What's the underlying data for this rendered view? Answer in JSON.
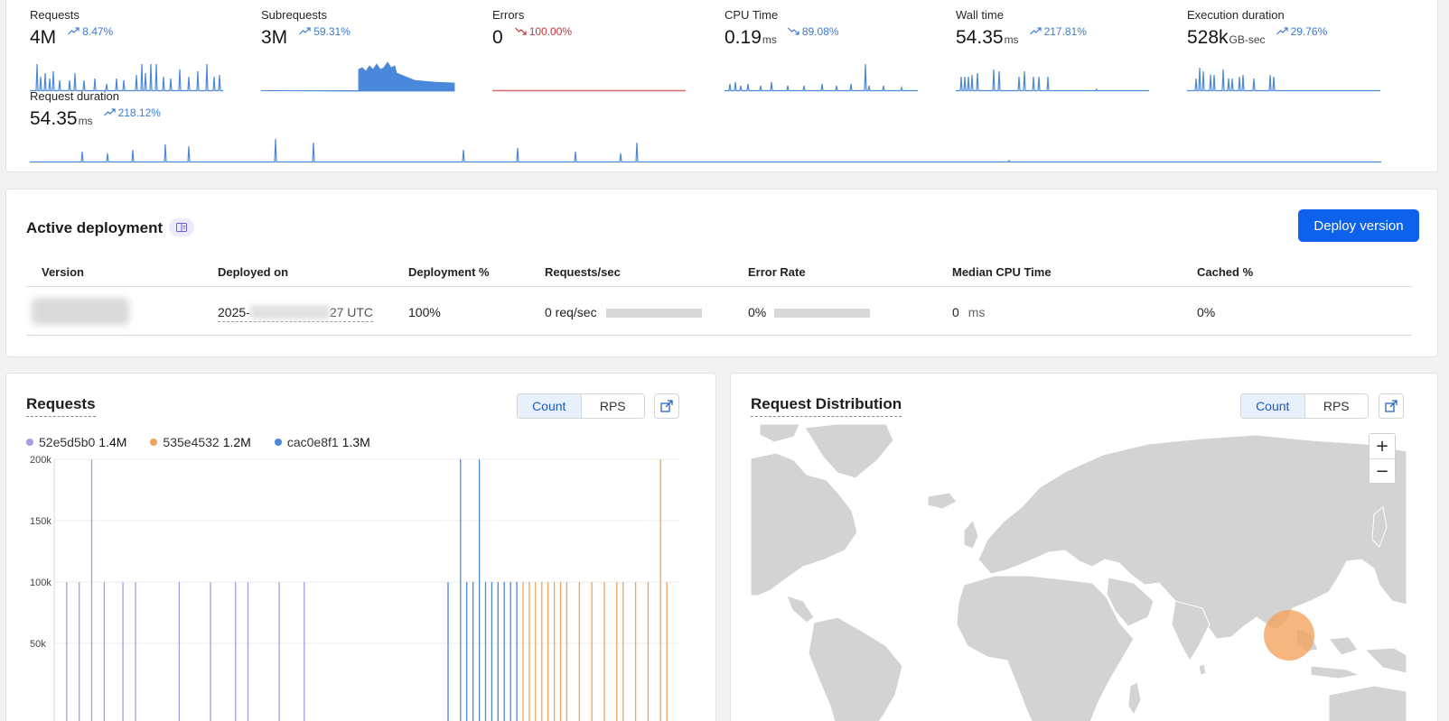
{
  "metrics": [
    {
      "label": "Requests",
      "value": "4M",
      "unit": "",
      "delta": "8.47%",
      "trend": "up"
    },
    {
      "label": "Subrequests",
      "value": "3M",
      "unit": "",
      "delta": "59.31%",
      "trend": "up"
    },
    {
      "label": "Errors",
      "value": "0",
      "unit": "",
      "delta": "100.00%",
      "trend": "down"
    },
    {
      "label": "CPU Time",
      "value": "0.19",
      "unit": "ms",
      "delta": "89.08%",
      "trend": "down"
    },
    {
      "label": "Wall time",
      "value": "54.35",
      "unit": "ms",
      "delta": "217.81%",
      "trend": "up"
    },
    {
      "label": "Execution duration",
      "value": "528k",
      "unit": "GB-sec",
      "delta": "29.76%",
      "trend": "up"
    }
  ],
  "request_duration": {
    "label": "Request duration",
    "value": "54.35",
    "unit": "ms",
    "delta": "218.12%",
    "trend": "up"
  },
  "deployment": {
    "title": "Active deployment",
    "button": "Deploy version",
    "columns": [
      "Version",
      "Deployed on",
      "Deployment %",
      "Requests/sec",
      "Error Rate",
      "Median CPU Time",
      "Cached %"
    ],
    "row": {
      "deployed_on_prefix": "2025-",
      "deployed_on_suffix": "27 UTC",
      "deployment_pct": "100%",
      "requests_sec": "0 req/sec",
      "error_rate": "0%",
      "median_cpu": "0",
      "median_cpu_unit": "ms",
      "cached": "0%"
    }
  },
  "requests_panel": {
    "title": "Requests",
    "toggle": [
      "Count",
      "RPS"
    ],
    "active_toggle": "Count",
    "legend": [
      {
        "name": "52e5d5b0",
        "value": "1.4M",
        "color": "#a99be0"
      },
      {
        "name": "535e4532",
        "value": "1.2M",
        "color": "#f0a35e"
      },
      {
        "name": "cac0e8f1",
        "value": "1.3M",
        "color": "#4a88d9"
      }
    ]
  },
  "distribution_panel": {
    "title": "Request Distribution",
    "toggle": [
      "Count",
      "RPS"
    ],
    "active_toggle": "Count",
    "zoom_in": "+",
    "zoom_out": "−",
    "highlight_color": "#f4a460"
  },
  "chart_data": {
    "type": "bar",
    "title": "Requests",
    "ylim": [
      0,
      200000
    ],
    "yticks": [
      "200k",
      "150k",
      "100k",
      "50k"
    ],
    "grid": true,
    "series": [
      {
        "name": "52e5d5b0",
        "color": "#a99be0",
        "x": [
          2,
          4,
          6,
          8,
          11,
          13,
          20,
          25,
          29,
          31,
          36,
          40
        ],
        "values": [
          100000,
          100000,
          200000,
          100000,
          100000,
          100000,
          100000,
          100000,
          100000,
          100000,
          100000,
          100000
        ]
      },
      {
        "name": "cac0e8f1",
        "color": "#4a88d9",
        "x": [
          63,
          65,
          66,
          67,
          68,
          69,
          70,
          71,
          72,
          73,
          74
        ],
        "values": [
          100000,
          200000,
          100000,
          100000,
          200000,
          100000,
          100000,
          100000,
          100000,
          100000,
          100000
        ]
      },
      {
        "name": "535e4532",
        "color": "#f0a35e",
        "x": [
          75,
          76,
          77,
          78,
          79,
          80,
          81,
          82,
          84,
          86,
          88,
          90,
          91,
          93,
          95,
          97,
          98
        ],
        "values": [
          100000,
          100000,
          100000,
          100000,
          100000,
          100000,
          100000,
          100000,
          100000,
          100000,
          100000,
          100000,
          100000,
          100000,
          100000,
          200000,
          100000
        ]
      }
    ]
  }
}
